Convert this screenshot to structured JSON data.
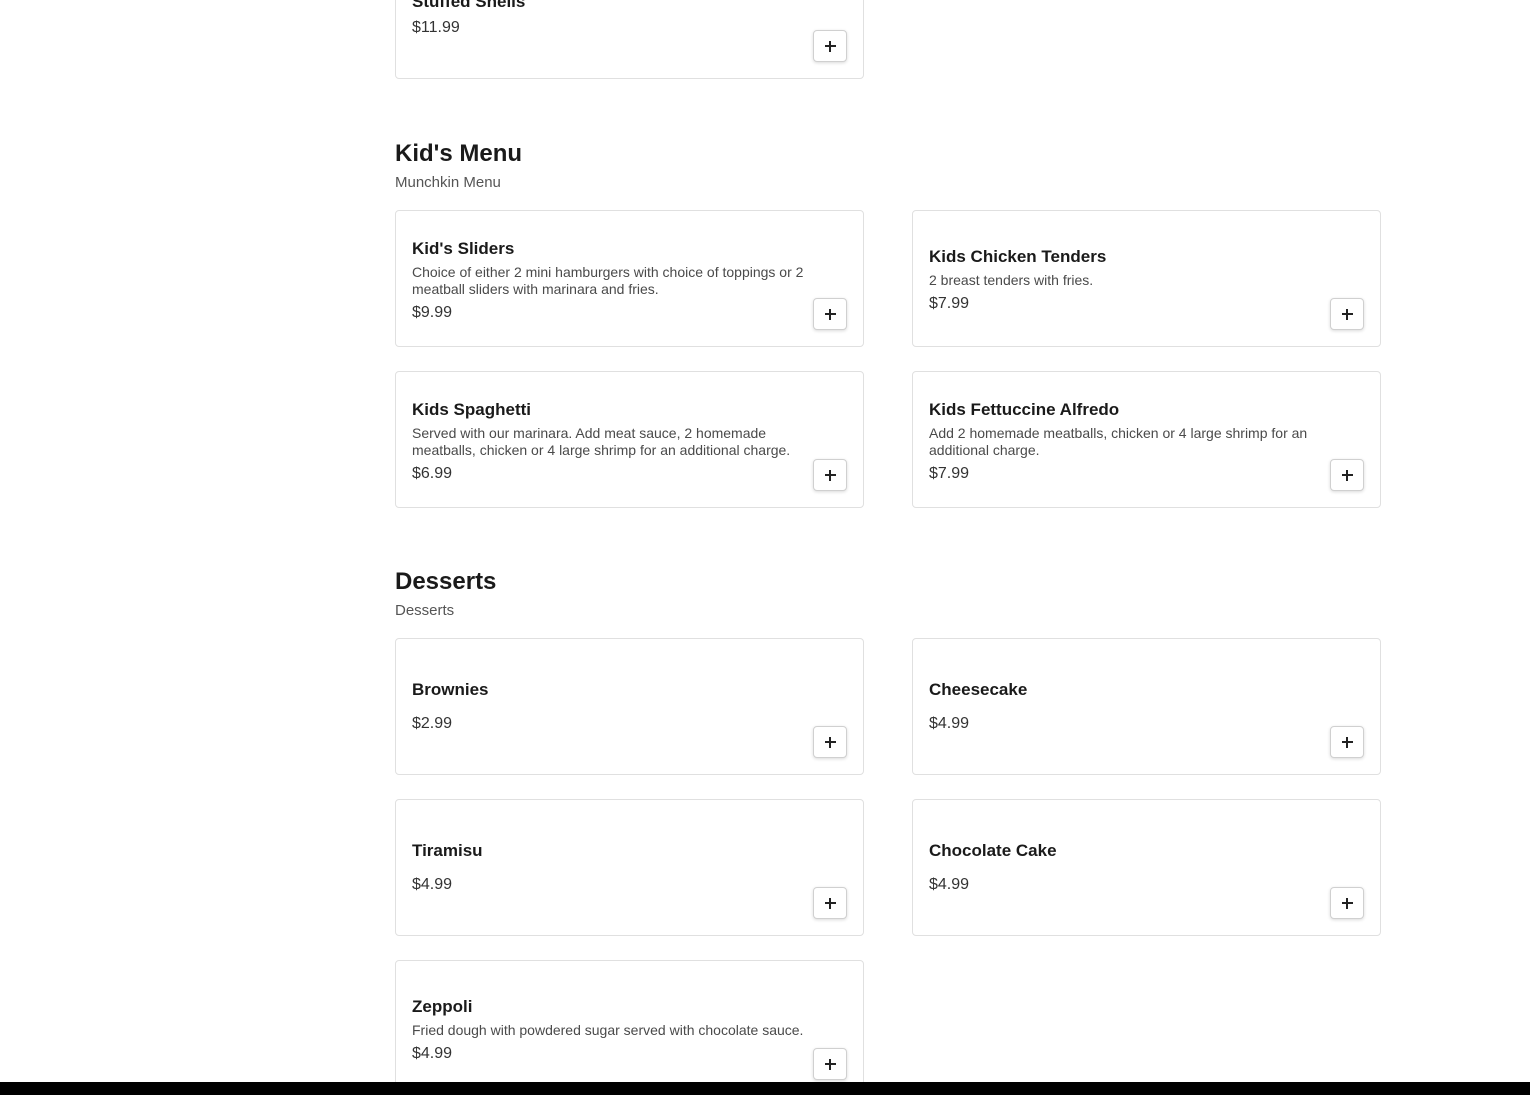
{
  "top_card": {
    "name": "Stuffed Shells",
    "price": "$11.99"
  },
  "sections": {
    "kids": {
      "title": "Kid's Menu",
      "subtitle": "Munchkin Menu",
      "items": [
        {
          "name": "Kid's Sliders",
          "desc": "Choice of either 2 mini hamburgers with choice of toppings or 2 meatball sliders with marinara and fries.",
          "price": "$9.99"
        },
        {
          "name": "Kids Chicken Tenders",
          "desc": "2 breast tenders with fries.",
          "price": "$7.99"
        },
        {
          "name": "Kids Spaghetti",
          "desc": "Served with our marinara. Add meat sauce, 2 homemade meatballs, chicken or 4 large shrimp for an additional charge.",
          "price": "$6.99"
        },
        {
          "name": "Kids Fettuccine Alfredo",
          "desc": "Add 2 homemade meatballs, chicken or 4 large shrimp for an additional charge.",
          "price": "$7.99"
        }
      ]
    },
    "desserts": {
      "title": "Desserts",
      "subtitle": "Desserts",
      "items": [
        {
          "name": "Brownies",
          "price": "$2.99"
        },
        {
          "name": "Cheesecake",
          "price": "$4.99"
        },
        {
          "name": "Tiramisu",
          "price": "$4.99"
        },
        {
          "name": "Chocolate Cake",
          "price": "$4.99"
        },
        {
          "name": "Zeppoli",
          "desc": "Fried dough with powdered sugar served with chocolate sauce.",
          "price": "$4.99"
        }
      ]
    }
  },
  "add_icon": "plus-icon"
}
